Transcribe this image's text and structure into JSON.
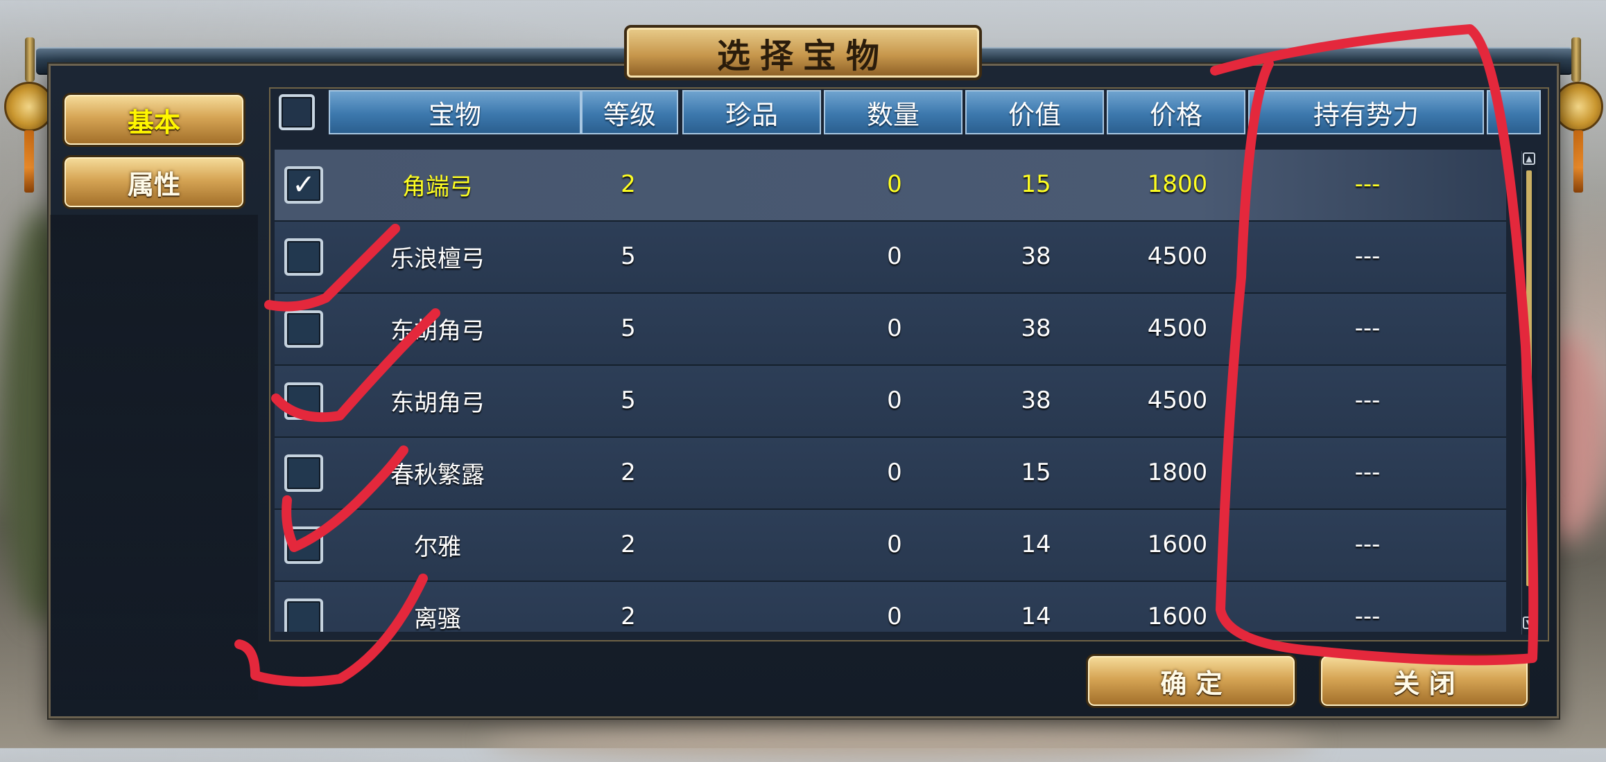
{
  "title": "选择宝物",
  "side_tabs": [
    {
      "label": "基本",
      "active": true
    },
    {
      "label": "属性",
      "active": false
    }
  ],
  "table": {
    "headers": [
      "宝物",
      "等级",
      "珍品",
      "数量",
      "价值",
      "价格",
      "持有势力"
    ],
    "rows": [
      {
        "checked": true,
        "name": "角端弓",
        "level": "2",
        "rare": "",
        "qty": "0",
        "value": "15",
        "price": "1800",
        "owner": "---"
      },
      {
        "checked": false,
        "name": "乐浪檀弓",
        "level": "5",
        "rare": "",
        "qty": "0",
        "value": "38",
        "price": "4500",
        "owner": "---"
      },
      {
        "checked": false,
        "name": "东胡角弓",
        "level": "5",
        "rare": "",
        "qty": "0",
        "value": "38",
        "price": "4500",
        "owner": "---"
      },
      {
        "checked": false,
        "name": "东胡角弓",
        "level": "5",
        "rare": "",
        "qty": "0",
        "value": "38",
        "price": "4500",
        "owner": "---"
      },
      {
        "checked": false,
        "name": "春秋繁露",
        "level": "2",
        "rare": "",
        "qty": "0",
        "value": "15",
        "price": "1800",
        "owner": "---"
      },
      {
        "checked": false,
        "name": "尔雅",
        "level": "2",
        "rare": "",
        "qty": "0",
        "value": "14",
        "price": "1600",
        "owner": "---"
      },
      {
        "checked": false,
        "name": "离骚",
        "level": "2",
        "rare": "",
        "qty": "0",
        "value": "14",
        "price": "1600",
        "owner": "---"
      }
    ]
  },
  "buttons": {
    "confirm": "确 定",
    "close": "关 闭"
  },
  "colors": {
    "selected_text": "#ffff22",
    "header_blue": "#3c78ad",
    "gold": "#d6a555",
    "ink_red": "#e4283c"
  }
}
